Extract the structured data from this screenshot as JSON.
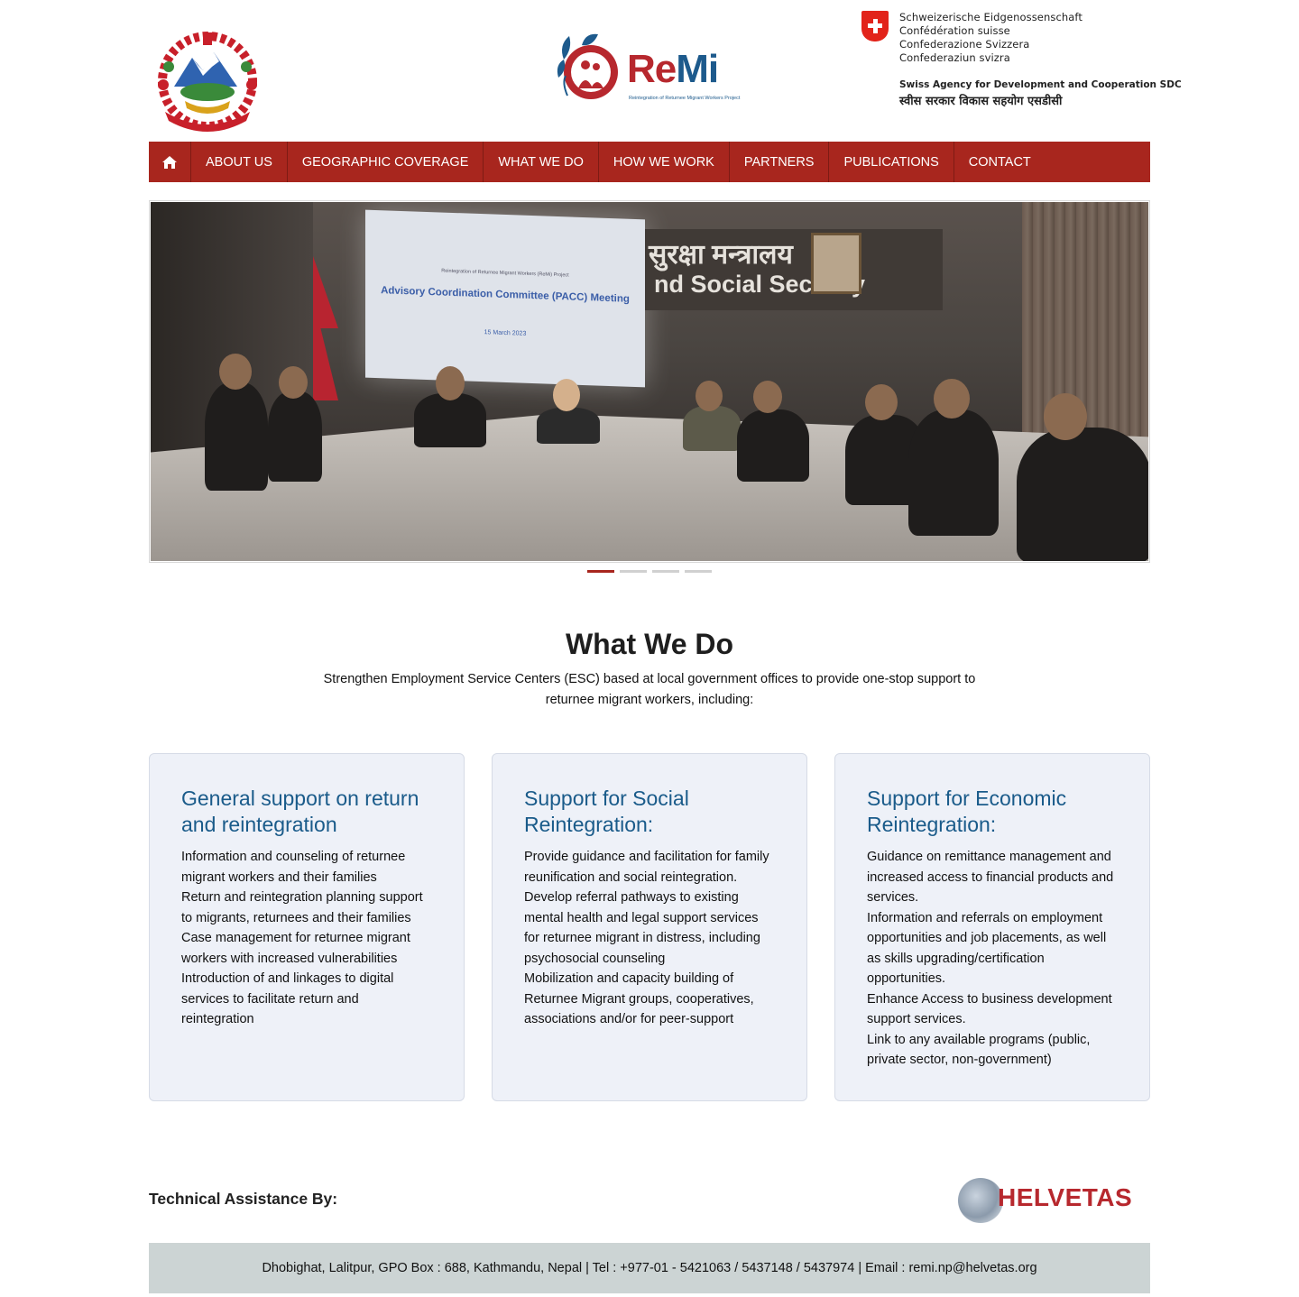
{
  "header": {
    "remi": {
      "brand_re": "Re",
      "brand_mi": "Mi",
      "subtitle": "Reintegration of Returnee Migrant Workers Project"
    },
    "sdc": {
      "languages": [
        "Schweizerische Eidgenossenschaft",
        "Confédération suisse",
        "Confederazione Svizzera",
        "Confederaziun svizra"
      ],
      "agency": "Swiss Agency for Development and Cooperation SDC",
      "agency_nepali": "स्वीस सरकार विकास सहयोग एसडीसी"
    }
  },
  "nav": {
    "home_icon": "home-icon",
    "items": [
      "ABOUT US",
      "GEOGRAPHIC COVERAGE",
      "WHAT WE DO",
      "HOW WE WORK",
      "PARTNERS",
      "PUBLICATIONS",
      "CONTACT"
    ]
  },
  "slider": {
    "slide_screen": {
      "line1": "Reintegration of Returnee Migrant Workers (ReMi) Project",
      "line2": "Advisory Coordination Committee (PACC) Meeting",
      "line3": "15 March 2023"
    },
    "wall_text": {
      "line1": "सुरक्षा मन्त्रालय",
      "line2": "nd Social Security"
    },
    "dot_count": 4,
    "active_index": 0
  },
  "what_we_do": {
    "title": "What We Do",
    "intro": "Strengthen Employment Service Centers (ESC) based at local government offices to provide one-stop support to returnee migrant workers, including:",
    "cards": [
      {
        "title": "General support on return and reintegration",
        "items": [
          "Information and counseling of returnee migrant workers and their families",
          "Return and reintegration planning support to migrants, returnees and their families",
          "Case management for returnee migrant workers with increased vulnerabilities",
          "Introduction of and linkages to digital services to facilitate return and reintegration"
        ]
      },
      {
        "title": "Support for Social Reintegration:",
        "items": [
          "Provide guidance and facilitation for family reunification and social reintegration.",
          "Develop referral pathways to existing mental health and legal support services for returnee migrant in distress, including psychosocial counseling",
          "Mobilization and capacity building of Returnee Migrant groups, cooperatives, associations and/or for peer-support"
        ]
      },
      {
        "title": "Support for Economic Reintegration:",
        "items": [
          "Guidance on remittance management and increased access to financial products and services.",
          "Information and referrals on employment opportunities and job placements, as well as skills upgrading/certification opportunities.",
          "Enhance Access to business development support services.",
          "Link to any available programs (public, private sector, non-government)"
        ]
      }
    ]
  },
  "footer": {
    "technical_assistance": "Technical Assistance By:",
    "helvetas": "HELVETAS",
    "contact": "Dhobighat, Lalitpur, GPO Box : 688, Kathmandu, Nepal | Tel : +977-01 - 5421063 / 5437148 / 5437974 | Email : remi.np@helvetas.org"
  },
  "colors": {
    "nav_bg": "#a8261e",
    "card_title": "#1a5b8a",
    "card_bg": "#eef1f8",
    "footer_bg": "#ccd4d4"
  }
}
